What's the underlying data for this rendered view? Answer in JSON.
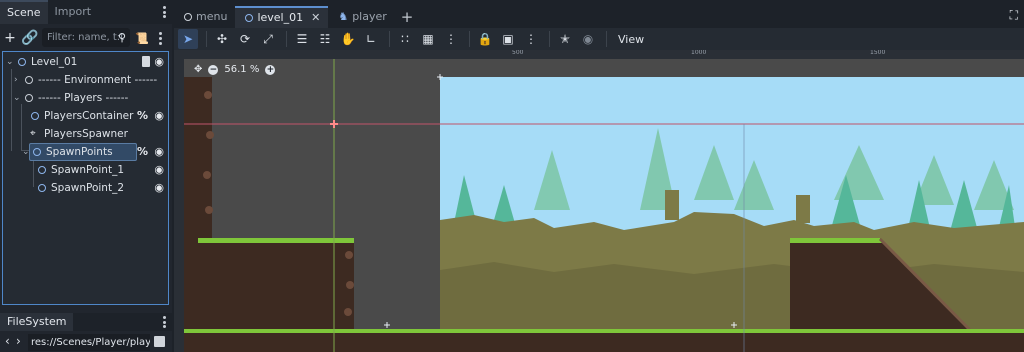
{
  "left_dock": {
    "tabs": [
      "Scene",
      "Import"
    ],
    "filter_placeholder": "Filter: name, t:t",
    "tree": [
      {
        "label": "Level_01",
        "depth": 0,
        "expanded": true,
        "icon": "node2d-icon",
        "extras": [
          "script-icon",
          "eye-icon"
        ]
      },
      {
        "label": "------ Environment ------",
        "depth": 1,
        "expanded": false,
        "icon": "node-icon",
        "extras": []
      },
      {
        "label": "------ Players ------",
        "depth": 1,
        "expanded": true,
        "icon": "node-icon",
        "extras": []
      },
      {
        "label": "PlayersContainer",
        "depth": 2,
        "icon": "node2d-icon",
        "extras": [
          "unique-name-icon",
          "eye-icon"
        ]
      },
      {
        "label": "PlayersSpawner",
        "depth": 2,
        "icon": "multiplayer-spawner-icon",
        "extras": []
      },
      {
        "label": "SpawnPoints",
        "depth": 2,
        "expanded": true,
        "selected": true,
        "icon": "node2d-icon",
        "extras": [
          "unique-name-icon",
          "eye-icon"
        ]
      },
      {
        "label": "SpawnPoint_1",
        "depth": 3,
        "icon": "node2d-icon",
        "extras": [
          "eye-icon"
        ]
      },
      {
        "label": "SpawnPoint_2",
        "depth": 3,
        "icon": "node2d-icon",
        "extras": [
          "eye-icon"
        ]
      }
    ],
    "filesystem_tab": "FileSystem",
    "filesystem_path": "res://Scenes/Player/player.t"
  },
  "main": {
    "scene_tabs": [
      {
        "label": "menu",
        "icon": "node-icon",
        "active": false,
        "closable": false
      },
      {
        "label": "level_01",
        "icon": "node2d-icon",
        "active": true,
        "closable": true
      },
      {
        "label": "player",
        "icon": "character-icon",
        "active": false,
        "closable": false
      }
    ],
    "toolbar": {
      "view_label": "View"
    },
    "viewport": {
      "zoom": "56.1 %",
      "ruler_labels": [
        "500",
        "1000",
        "1500"
      ]
    }
  },
  "colors": {
    "accent": "#5d8fcf",
    "selection": "#324a66",
    "sky": "#a6dcf7",
    "grass": "#7fc63a",
    "dirt": "#3d2a21"
  }
}
